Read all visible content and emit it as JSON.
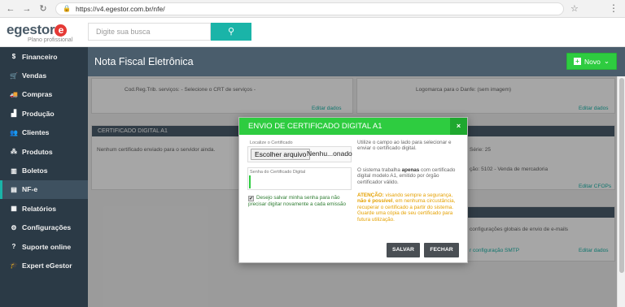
{
  "browser": {
    "url": "https://v4.egestor.com.br/nfe/"
  },
  "header": {
    "brand": "egestor",
    "brand_tagline": "Plano profissional",
    "search_placeholder": "Digite sua busca"
  },
  "sidebar": {
    "items": [
      {
        "icon": "dollar-icon",
        "glyph": "$",
        "label": "Financeiro",
        "active": false
      },
      {
        "icon": "cart-icon",
        "glyph": "🛒",
        "label": "Vendas",
        "active": false
      },
      {
        "icon": "truck-icon",
        "glyph": "🚚",
        "label": "Compras",
        "active": false
      },
      {
        "icon": "factory-icon",
        "glyph": "▟",
        "label": "Produção",
        "active": false
      },
      {
        "icon": "users-icon",
        "glyph": "👥",
        "label": "Clientes",
        "active": false
      },
      {
        "icon": "cubes-icon",
        "glyph": "⁂",
        "label": "Produtos",
        "active": false
      },
      {
        "icon": "barcode-icon",
        "glyph": "▥",
        "label": "Boletos",
        "active": false
      },
      {
        "icon": "file-icon",
        "glyph": "▤",
        "label": "NF-e",
        "active": true
      },
      {
        "icon": "bar-chart-icon",
        "glyph": "▦",
        "label": "Relatórios",
        "active": false
      },
      {
        "icon": "gears-icon",
        "glyph": "⚙",
        "label": "Configurações",
        "active": false
      },
      {
        "icon": "question-icon",
        "glyph": "?",
        "label": "Suporte online",
        "active": false
      },
      {
        "icon": "graduation-cap-icon",
        "glyph": "🎓",
        "label": "Expert eGestor",
        "active": false
      }
    ]
  },
  "page": {
    "title": "Nota Fiscal Eletrônica",
    "new_button": "Novo"
  },
  "background": {
    "row1_left": "Cod.Reg.Trib. serviços: - Selecione o CRT de serviços -",
    "row1_right": "Logomarca para o Danfe: (sem imagem)",
    "edit_link_1": "Editar dados",
    "edit_link_2": "Editar dados",
    "cert_panel_title": "CERTIFICADO DIGITAL A1",
    "cert_panel_text": "Nenhum certificado enviado para o servidor ainda.",
    "right_text_1": "Série: 25",
    "right_text_2": "ção: 5102 - Venda de mercadoria",
    "edit_cfops": "Editar CFOPs",
    "smtp_text": "configurações globais de envio de e-mails",
    "smtp_link": "r configuração SMTP",
    "edit_link_3": "Editar dados"
  },
  "modal": {
    "title": "ENVIO DE CERTIFICADO DIGITAL A1",
    "close_glyph": "×",
    "locate_label": "Localize o Certificado",
    "file_button": "Escolher arquivo",
    "file_name": "Nenhu...onado",
    "password_label": "Senha do Certificado Digital",
    "password_value": "",
    "save_password_text": "Desejo salvar minha senha para não precisar digitar novamente a cada emissão",
    "save_password_checked": true,
    "help_1": "Utilize o campo ao lado para selecionar e enviar o certificado digital.",
    "help_2_pre": "O sistema trabalha ",
    "help_2_bold": "apenas",
    "help_2_post": " com certificado digital modelo A1, emitido por órgão certificador válido.",
    "attention_label": "ATENÇÃO:",
    "attention_pre": " visando sempre a segurança, ",
    "attention_bold": "não é possível",
    "attention_post": ", em nenhuma circustância, recuperar o certificado a partir do sistema. Guarde uma cópia de seu certificado para futura utilização.",
    "save_button": "SALVAR",
    "close_button": "FECHAR"
  },
  "colors": {
    "accent_green": "#2ecc40",
    "teal": "#1ab4a8",
    "sidebar_bg": "#2b3a46",
    "title_bar": "#4a5d6c"
  }
}
